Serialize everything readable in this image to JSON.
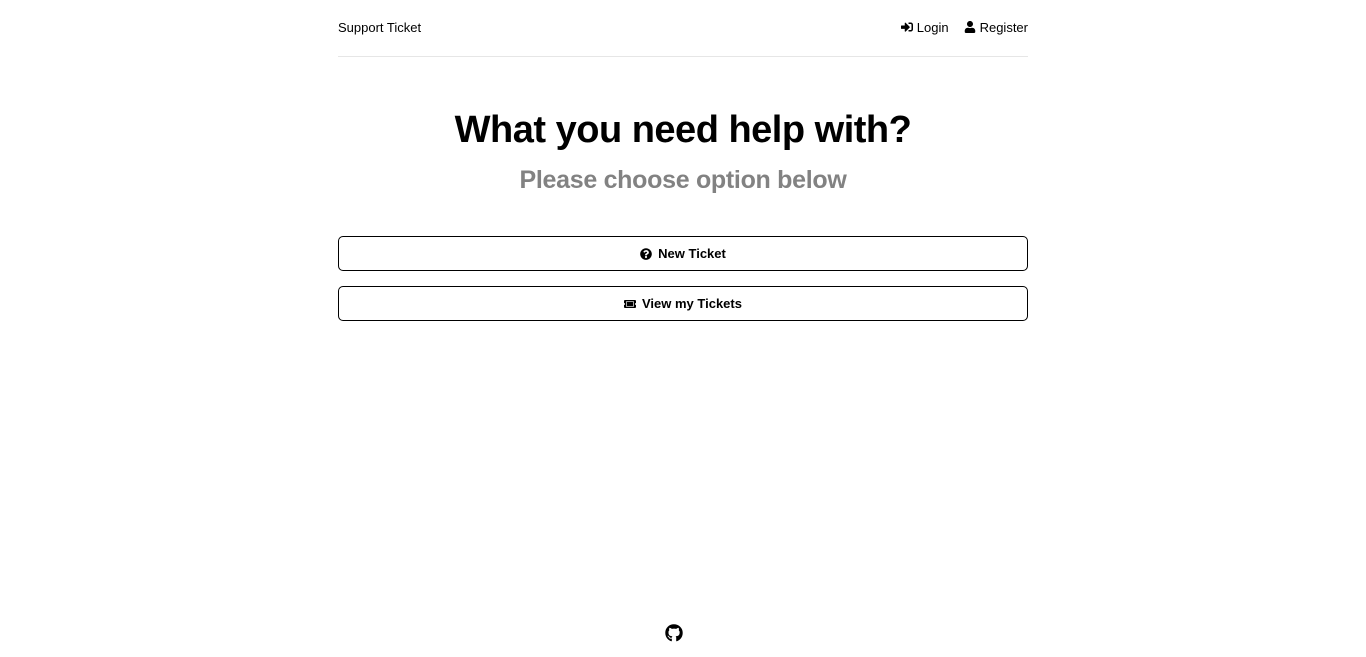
{
  "header": {
    "brand": "Support Ticket",
    "nav": [
      {
        "label": "Login",
        "icon": "sign-in-icon"
      },
      {
        "label": "Register",
        "icon": "user-icon"
      }
    ]
  },
  "hero": {
    "title": "What you need help with?",
    "subtitle": "Please choose option below"
  },
  "actions": {
    "new_ticket": {
      "label": "New Ticket",
      "icon": "question-circle-icon"
    },
    "view_tickets": {
      "label": "View my Tickets",
      "icon": "ticket-icon"
    }
  },
  "footer": {
    "icon": "github-icon"
  },
  "colors": {
    "text": "#000000",
    "subtitle": "#828282",
    "border": "#000000",
    "divider": "#e6e6e6",
    "background": "#ffffff"
  }
}
